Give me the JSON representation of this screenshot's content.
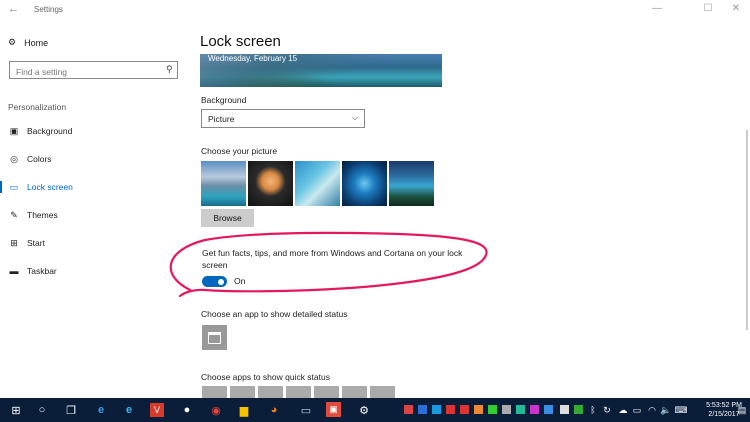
{
  "window": {
    "title": "Settings",
    "back_glyph": "←",
    "minimize_glyph": "—",
    "maximize_glyph": "☐",
    "close_glyph": "✕"
  },
  "sidebar": {
    "home_label": "Home",
    "search_placeholder": "Find a setting",
    "section_title": "Personalization",
    "items": [
      {
        "label": "Background",
        "icon": "picture-icon",
        "glyph": "▣"
      },
      {
        "label": "Colors",
        "icon": "palette-icon",
        "glyph": "◎"
      },
      {
        "label": "Lock screen",
        "icon": "monitor-icon",
        "glyph": "▭"
      },
      {
        "label": "Themes",
        "icon": "brush-icon",
        "glyph": "✎"
      },
      {
        "label": "Start",
        "icon": "start-icon",
        "glyph": "⊞"
      },
      {
        "label": "Taskbar",
        "icon": "taskbar-icon",
        "glyph": "▬"
      }
    ]
  },
  "main": {
    "title": "Lock screen",
    "preview_date": "Wednesday, February 15",
    "background_label": "Background",
    "background_value": "Picture",
    "choose_picture_label": "Choose your picture",
    "browse_label": "Browse",
    "fun_facts_text": "Get fun facts, tips, and more from Windows and Cortana on your lock screen",
    "toggle_state": "On",
    "toggle_on": true,
    "detailed_status_label": "Choose an app to show detailed status",
    "quick_status_label": "Choose apps to show quick status"
  },
  "taskbar": {
    "time": "5:53:52 PM",
    "date": "2/15/2017",
    "accent_color": "#0067c0",
    "annotation_color": "#e5185e"
  }
}
